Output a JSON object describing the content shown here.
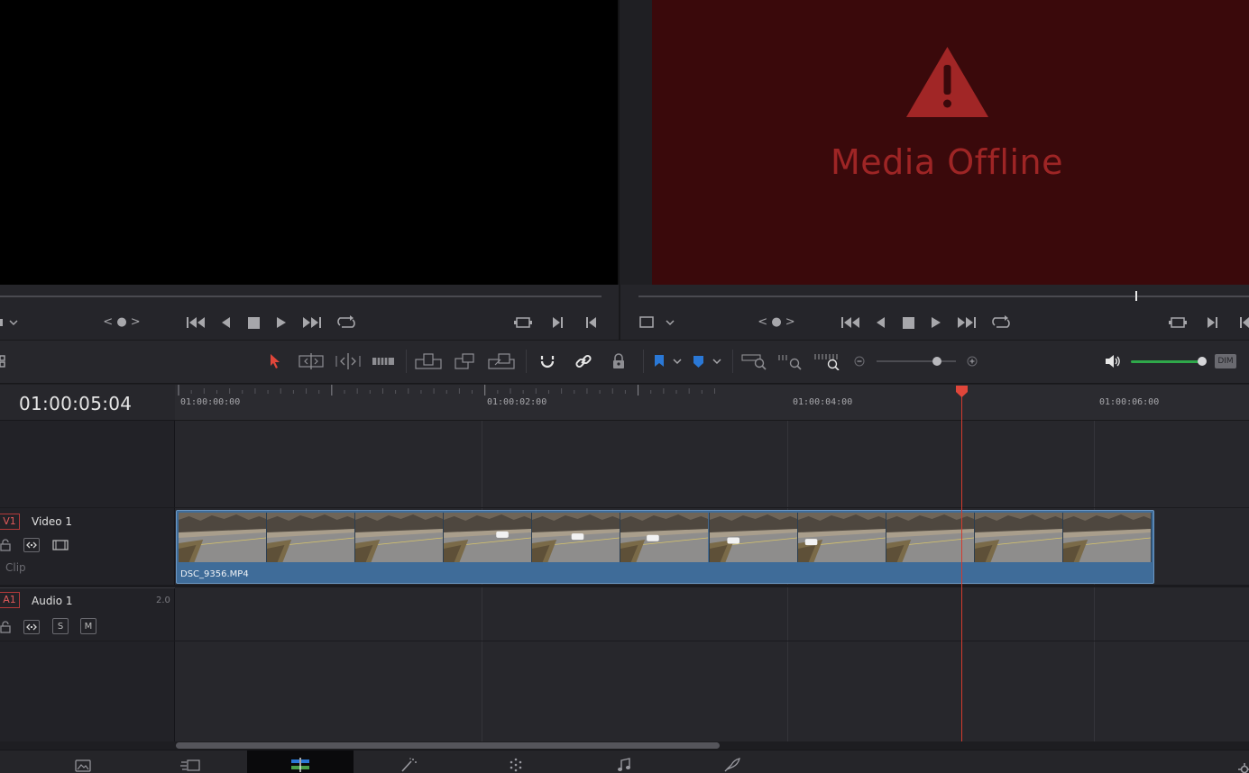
{
  "viewer": {
    "offline_text": "Media Offline"
  },
  "transport": {
    "source_nav": "< ● >",
    "timeline_nav": "< ● >"
  },
  "timeline": {
    "timecode": "01:00:05:04",
    "ruler_labels": [
      "01:00:00:00",
      "01:00:02:00",
      "01:00:04:00",
      "01:00:06:00"
    ],
    "dim_label": "DIM"
  },
  "tracks": {
    "video": {
      "id": "V1",
      "name": "Video 1",
      "clip_label": "Clip"
    },
    "audio": {
      "id": "A1",
      "name": "Audio 1",
      "channels": "2.0",
      "solo": "S",
      "mute": "M"
    }
  },
  "clip": {
    "name": "DSC_9356.MP4"
  },
  "colors": {
    "playhead": "#d23b2e",
    "clip": "#3f6c99",
    "offline_bg": "#3a090b",
    "offline_text": "#9e2525",
    "volume": "#2fa84a",
    "flag": "#2a78d6"
  },
  "icons": {
    "transport": [
      "jump-start-icon",
      "step-back-icon",
      "stop-icon",
      "play-icon",
      "jump-end-icon",
      "loop-icon"
    ],
    "toolbar": [
      "selection-icon",
      "trim-icon",
      "dynamic-trim-icon",
      "blade-icon",
      "insert-icon",
      "overwrite-icon",
      "replace-icon",
      "snapping-icon",
      "linked-selection-icon",
      "position-lock-icon",
      "flag-icon",
      "marker-icon",
      "zoom-full-icon",
      "zoom-detail-icon",
      "zoom-custom-icon",
      "zoom-out-icon",
      "zoom-in-icon",
      "speaker-icon"
    ],
    "pages": [
      "media-page-icon",
      "cut-page-icon",
      "edit-page-icon",
      "fusion-page-icon",
      "color-page-icon",
      "fairlight-page-icon",
      "deliver-page-icon"
    ]
  },
  "volume_level": 0.96,
  "zoom_level": 0.78
}
